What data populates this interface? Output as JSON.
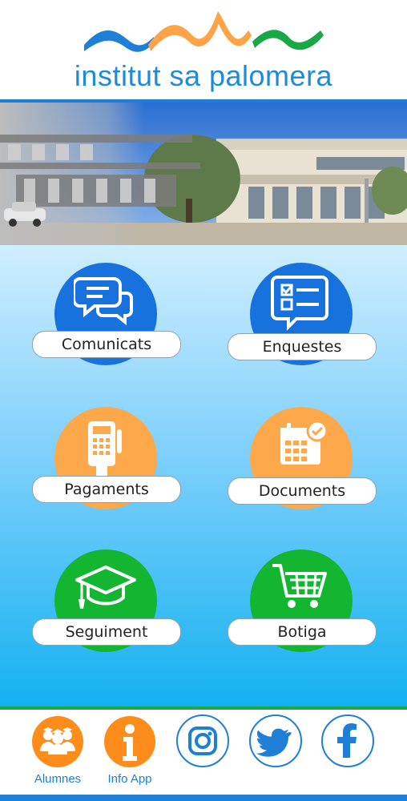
{
  "header": {
    "school_name": "institut sa palomera"
  },
  "tiles": [
    {
      "label": "Comunicats",
      "icon": "chat-bubbles-icon",
      "color": "#1772de"
    },
    {
      "label": "Enquestes",
      "icon": "survey-form-icon",
      "color": "#1772de"
    },
    {
      "label": "Pagaments",
      "icon": "card-terminal-icon",
      "color": "#fda84a"
    },
    {
      "label": "Documents",
      "icon": "calendar-check-icon",
      "color": "#fda84a"
    },
    {
      "label": "Seguiment",
      "icon": "graduation-cap-icon",
      "color": "#13b531"
    },
    {
      "label": "Botiga",
      "icon": "shopping-cart-icon",
      "color": "#13b531"
    }
  ],
  "footer": {
    "items": [
      {
        "label": "Alumnes",
        "icon": "students-icon"
      },
      {
        "label": "Info App",
        "icon": "info-icon"
      },
      {
        "label": "",
        "icon": "instagram-icon"
      },
      {
        "label": "",
        "icon": "twitter-icon"
      },
      {
        "label": "",
        "icon": "facebook-icon"
      }
    ]
  }
}
